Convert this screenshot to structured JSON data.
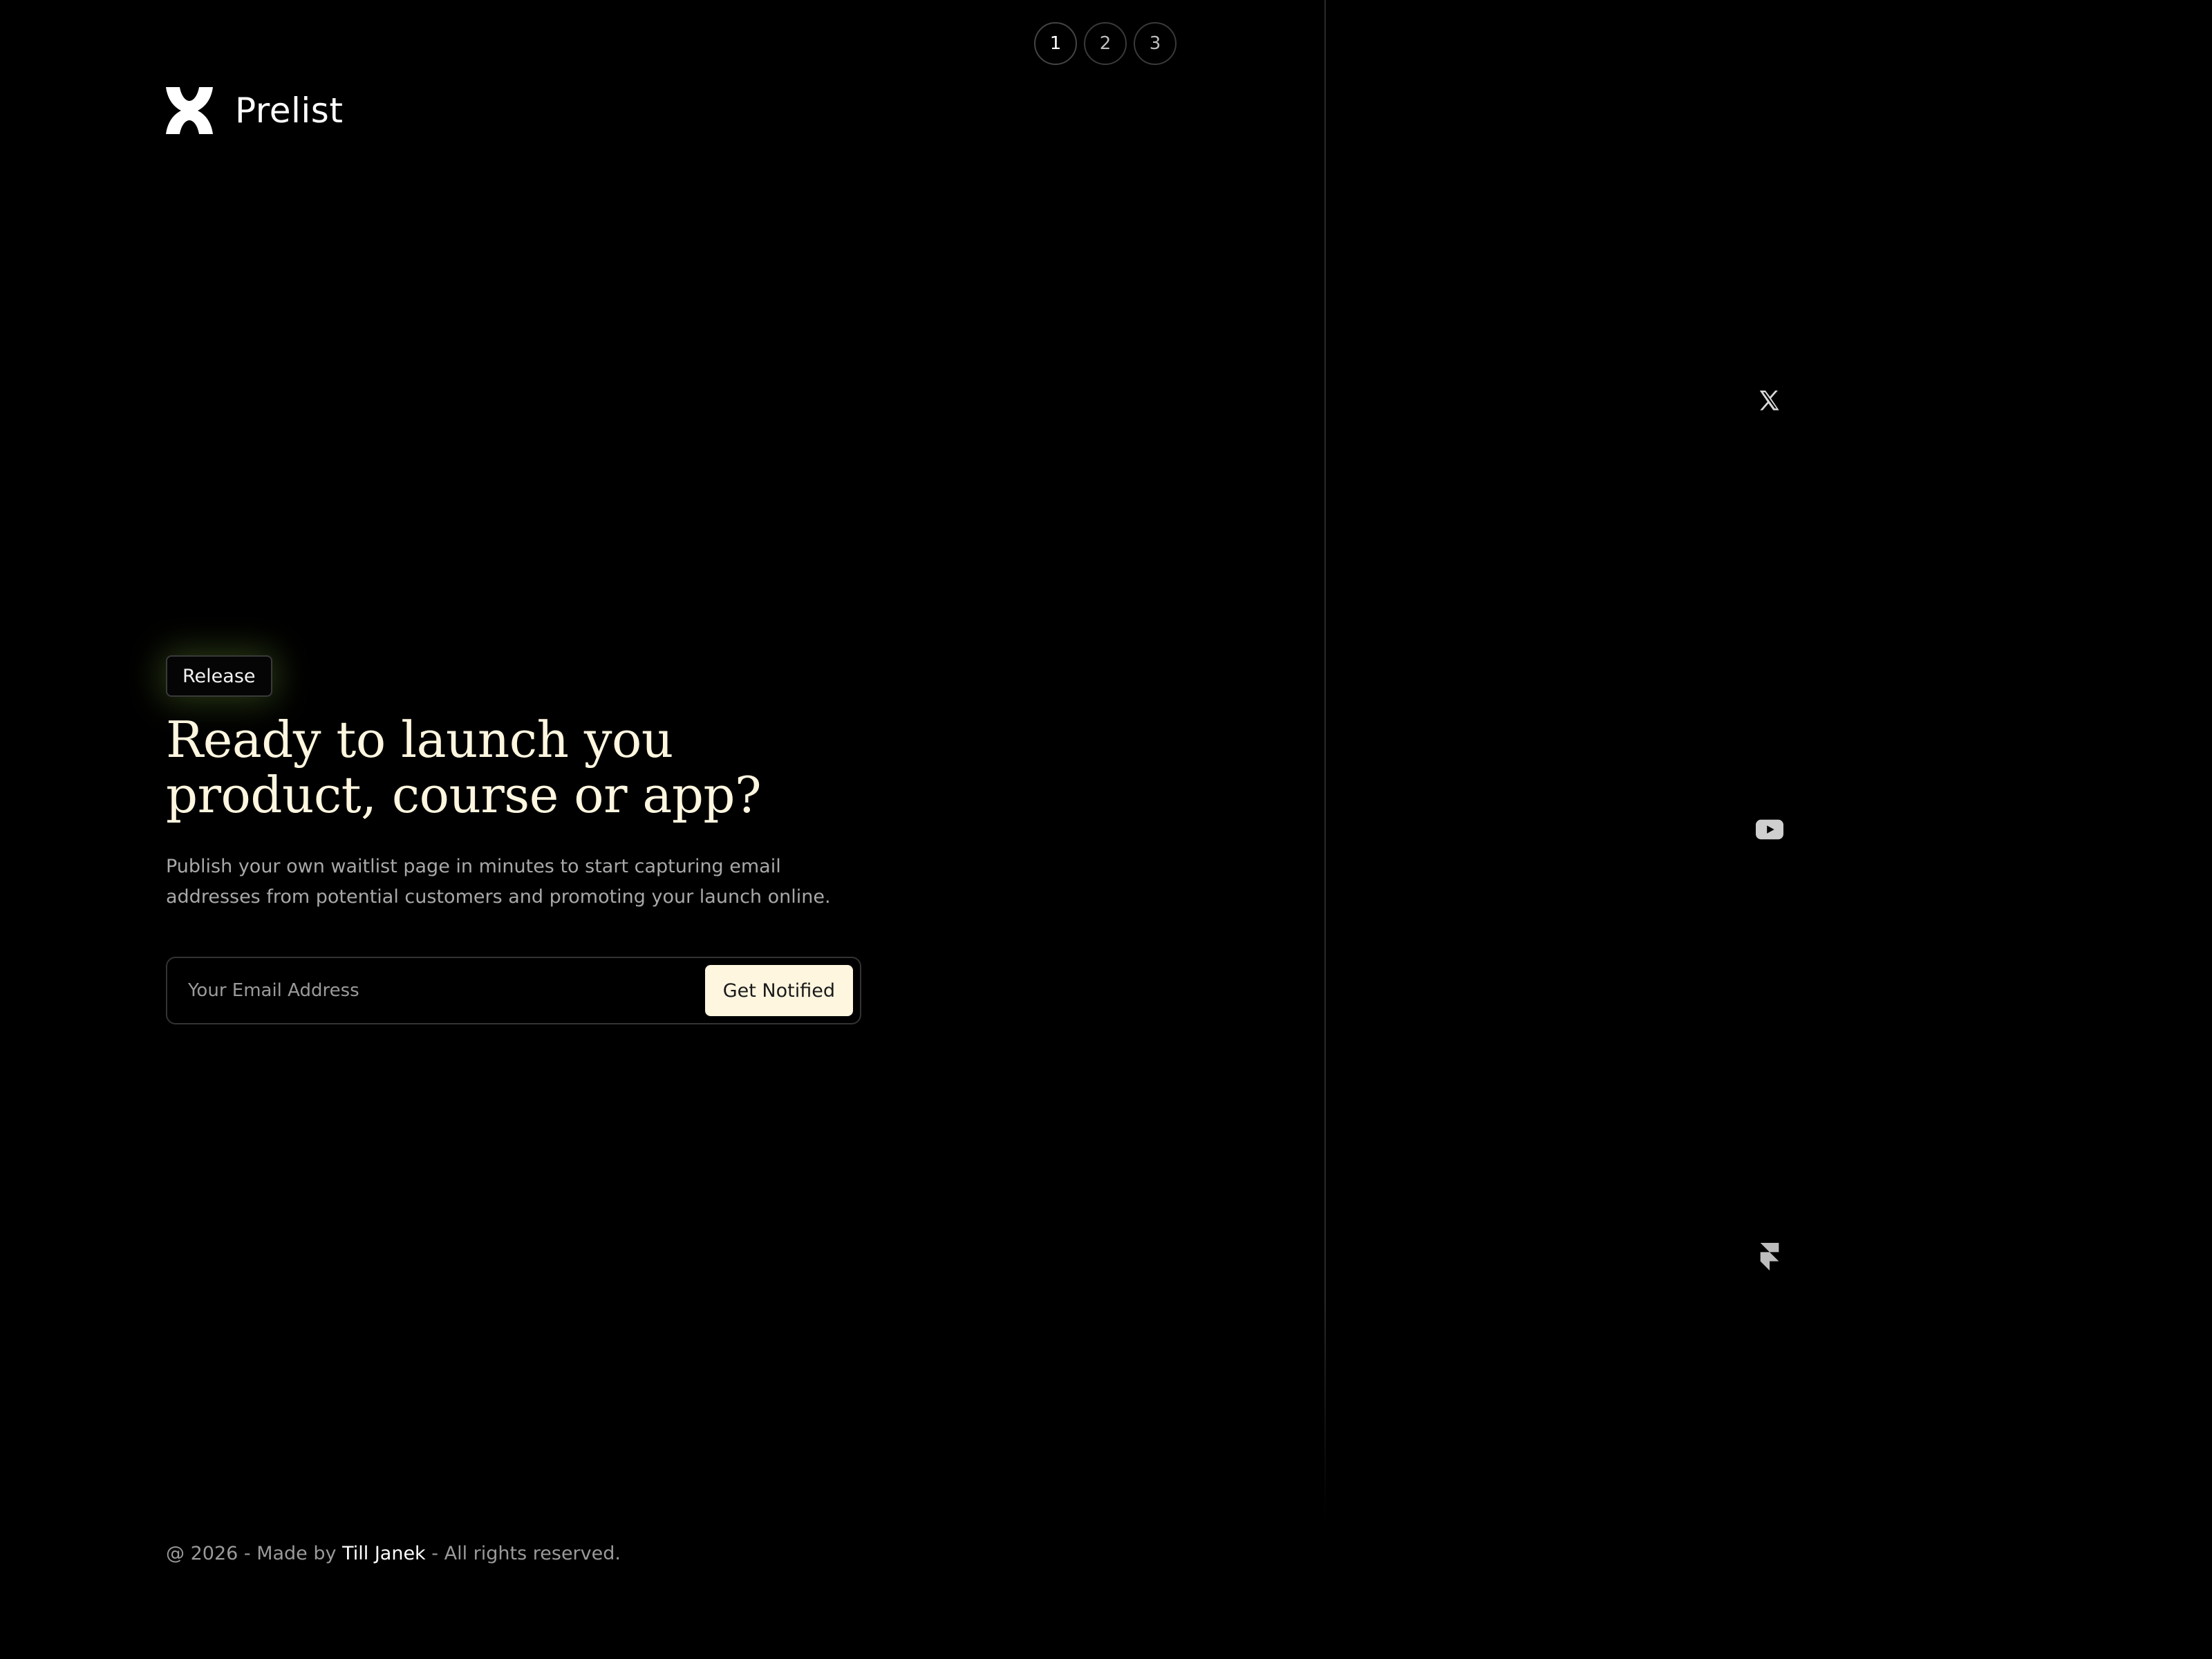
{
  "pagination": {
    "pages": [
      "1",
      "2",
      "3"
    ],
    "active": "1"
  },
  "brand": {
    "name": "Prelist",
    "logo_icon": "prelist-logo-icon"
  },
  "hero": {
    "badge": "Release",
    "headline_line1": "Ready to launch you",
    "headline_line2": "product, course or app?",
    "description_line1": "Publish your own waitlist page in minutes to start capturing email",
    "description_line2": "addresses from potential customers and promoting your launch online."
  },
  "signup": {
    "email_placeholder": "Your Email Address",
    "button_label": "Get Notified"
  },
  "footer": {
    "prefix": "@ 2026 - Made by ",
    "author": "Till Janek",
    "suffix": " - All rights reserved."
  },
  "social": [
    {
      "icon": "x-twitter-icon"
    },
    {
      "icon": "youtube-icon"
    },
    {
      "icon": "framer-icon"
    }
  ],
  "colors": {
    "background": "#000000",
    "headline": "#fff6df",
    "button_bg": "#fff6df",
    "badge_glow": "#7aaa3c",
    "muted_text": "#a8a8a8"
  }
}
